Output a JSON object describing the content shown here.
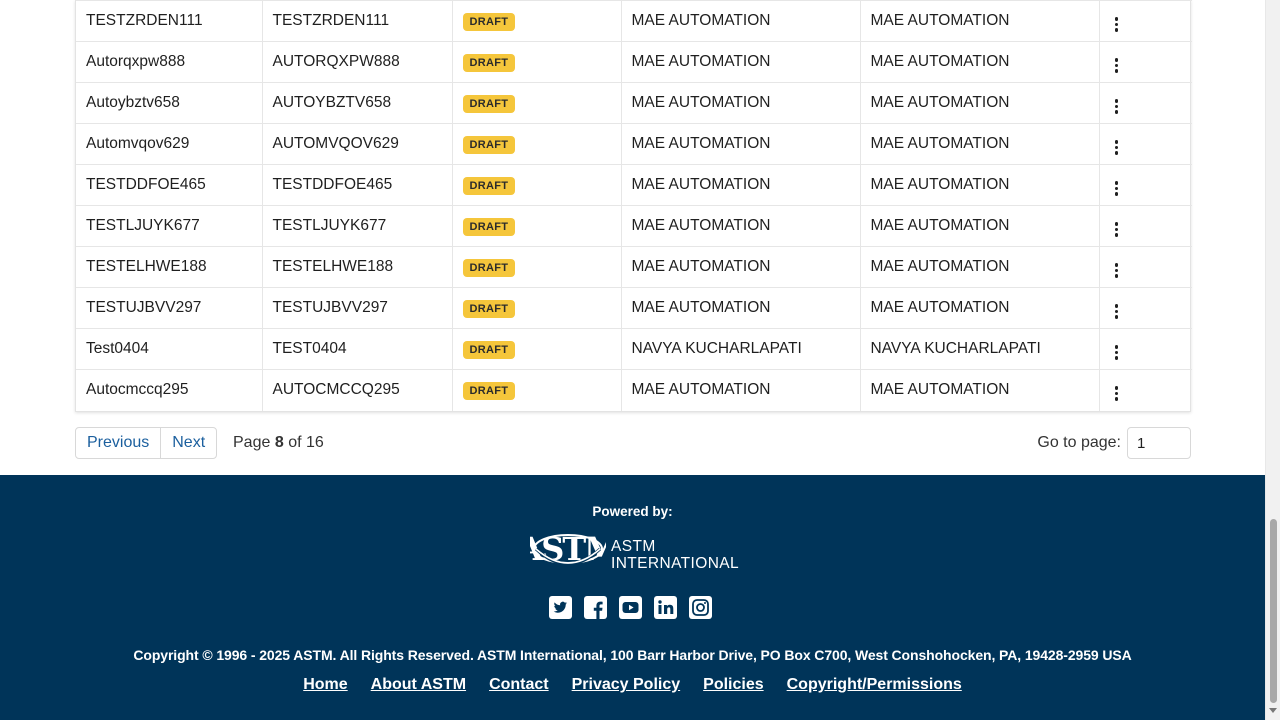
{
  "table": {
    "rows": [
      {
        "name": "TESTZRDEN111",
        "code": "TESTZRDEN111",
        "status": "DRAFT",
        "created_by": "MAE AUTOMATION",
        "modified_by": "MAE AUTOMATION"
      },
      {
        "name": "Autorqxpw888",
        "code": "AUTORQXPW888",
        "status": "DRAFT",
        "created_by": "MAE AUTOMATION",
        "modified_by": "MAE AUTOMATION"
      },
      {
        "name": "Autoybztv658",
        "code": "AUTOYBZTV658",
        "status": "DRAFT",
        "created_by": "MAE AUTOMATION",
        "modified_by": "MAE AUTOMATION"
      },
      {
        "name": "Automvqov629",
        "code": "AUTOMVQOV629",
        "status": "DRAFT",
        "created_by": "MAE AUTOMATION",
        "modified_by": "MAE AUTOMATION"
      },
      {
        "name": "TESTDDFOE465",
        "code": "TESTDDFOE465",
        "status": "DRAFT",
        "created_by": "MAE AUTOMATION",
        "modified_by": "MAE AUTOMATION"
      },
      {
        "name": "TESTLJUYK677",
        "code": "TESTLJUYK677",
        "status": "DRAFT",
        "created_by": "MAE AUTOMATION",
        "modified_by": "MAE AUTOMATION"
      },
      {
        "name": "TESTELHWE188",
        "code": "TESTELHWE188",
        "status": "DRAFT",
        "created_by": "MAE AUTOMATION",
        "modified_by": "MAE AUTOMATION"
      },
      {
        "name": "TESTUJBVV297",
        "code": "TESTUJBVV297",
        "status": "DRAFT",
        "created_by": "MAE AUTOMATION",
        "modified_by": "MAE AUTOMATION"
      },
      {
        "name": "Test0404",
        "code": "TEST0404",
        "status": "DRAFT",
        "created_by": "NAVYA KUCHARLAPATI",
        "modified_by": "NAVYA KUCHARLAPATI"
      },
      {
        "name": "Autocmccq295",
        "code": "AUTOCMCCQ295",
        "status": "DRAFT",
        "created_by": "MAE AUTOMATION",
        "modified_by": "MAE AUTOMATION"
      }
    ],
    "row_action_icon": "kebab-menu-icon",
    "status_color": "#f5c63b"
  },
  "pagination": {
    "previous_label": "Previous",
    "next_label": "Next",
    "page_prefix": "Page",
    "current_page": "8",
    "page_of": "of 16",
    "goto_label": "Go to page:",
    "goto_value": "1"
  },
  "footer": {
    "powered_by": "Powered by:",
    "logo_mark": "ASTM",
    "logo_line1": "ASTM",
    "logo_line2": "INTERNATIONAL",
    "social_icons": [
      "twitter-icon",
      "facebook-icon",
      "youtube-icon",
      "linkedin-icon",
      "instagram-icon"
    ],
    "copyright": "Copyright © 1996 - 2025 ASTM. All Rights Reserved. ASTM International, 100 Barr Harbor Drive, PO Box C700, West Conshohocken, PA, 19428-2959 USA",
    "links": [
      "Home",
      "About ASTM",
      "Contact",
      "Privacy Policy",
      "Policies",
      "Copyright/Permissions"
    ],
    "background_color": "#003459"
  },
  "colors": {
    "link_blue": "#1b5f9e"
  }
}
